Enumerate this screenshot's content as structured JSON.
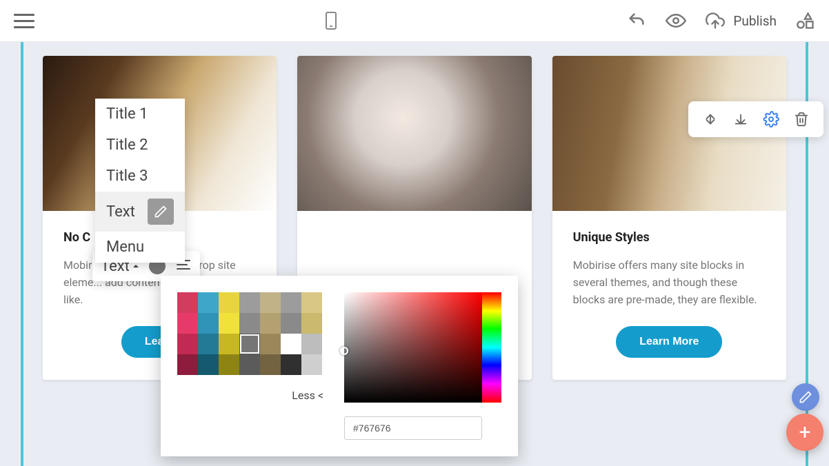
{
  "topbar": {
    "publish_label": "Publish"
  },
  "cards": [
    {
      "title": "No C",
      "text": "Mobirise is an easy ... just drop site eleme... add content and st... way you like.",
      "cta": "Learn"
    },
    {
      "title": "",
      "text": "",
      "cta": ""
    },
    {
      "title": "Unique Styles",
      "text": "Mobirise offers many site blocks in several themes, and though these blocks are pre-made, they are flexible.",
      "cta": "Learn More"
    }
  ],
  "style_menu": {
    "items": [
      "Title 1",
      "Title 2",
      "Title 3",
      "Text",
      "Menu"
    ],
    "selected_index": 3
  },
  "inline_toolbar": {
    "label": "Text"
  },
  "color_picker": {
    "less_label": "Less <",
    "hex_value": "#767676",
    "swatches_row0": [
      "#d33b5f",
      "#3ea7c9",
      "#e8d43c",
      "#9c9c9c",
      "#c2b288",
      "#9c9c9c",
      "#d9c885"
    ],
    "swatches_row1": [
      "#e83a6a",
      "#2f94b7",
      "#f1e23a",
      "#8a8a8a",
      "#b4a171",
      "#8a8a8a",
      "#cbb96e"
    ],
    "swatches_row2": [
      "#c22a53",
      "#227a97",
      "#c7b822",
      "#767676",
      "#9a875a",
      "#ffffff",
      "#bdbdbd"
    ],
    "swatches_row3": [
      "#8e1c3c",
      "#15596f",
      "#8d8414",
      "#5b5b5b",
      "#746340",
      "#303030",
      "#cfcfcf"
    ],
    "selected_swatch": {
      "row": 2,
      "col": 3
    }
  }
}
